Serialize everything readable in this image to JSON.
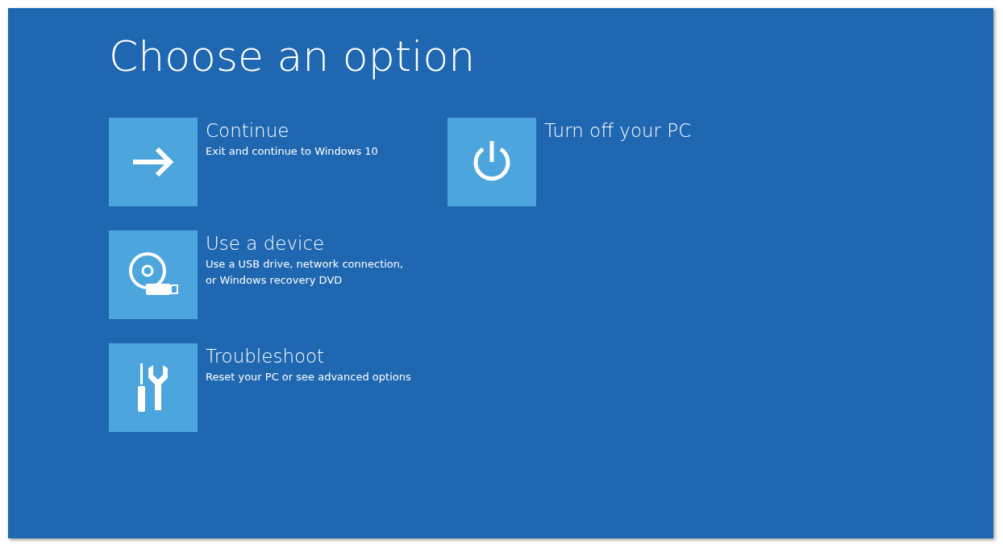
{
  "title": "Choose an option",
  "columns": [
    {
      "options": [
        {
          "kind": "arrow",
          "label": "Continue",
          "description": "Exit and continue to Windows 10"
        },
        {
          "kind": "device",
          "label": "Use a device",
          "description": "Use a USB drive, network connection,\nor Windows recovery DVD"
        },
        {
          "kind": "tools",
          "label": "Troubleshoot",
          "description": "Reset your PC or see advanced options"
        }
      ]
    },
    {
      "options": [
        {
          "kind": "power",
          "label": "Turn off your PC"
        }
      ]
    }
  ]
}
